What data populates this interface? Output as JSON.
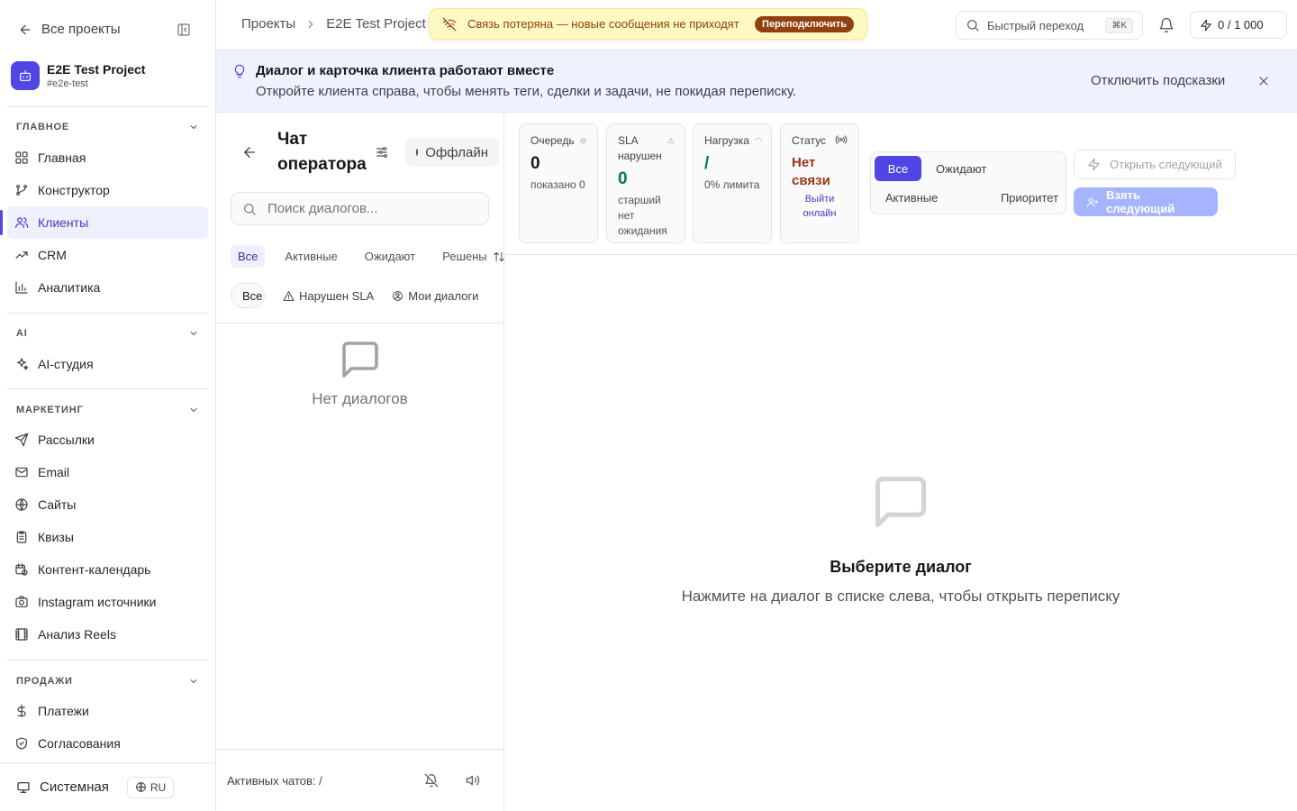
{
  "sidebar": {
    "back_label": "Все проекты",
    "project": {
      "name": "E2E Test Project",
      "slug": "#e2e-test"
    },
    "sections": {
      "main": {
        "title": "ГЛАВНОЕ",
        "items": [
          "Главная",
          "Конструктор",
          "Клиенты",
          "CRM",
          "Аналитика"
        ]
      },
      "ai": {
        "title": "AI",
        "items": [
          "AI-студия"
        ]
      },
      "marketing": {
        "title": "МАРКЕТИНГ",
        "items": [
          "Рассылки",
          "Email",
          "Сайты",
          "Квизы",
          "Контент-календарь",
          "Instagram источники",
          "Анализ Reels"
        ]
      },
      "sales": {
        "title": "ПРОДАЖИ",
        "items": [
          "Платежи",
          "Согласования"
        ]
      }
    },
    "active_item": "Клиенты",
    "theme_label": "Системная",
    "lang_label": "RU"
  },
  "header": {
    "breadcrumbs": [
      "Проекты",
      "E2E Test Project"
    ],
    "connection_banner": {
      "text": "Связь потеряна — новые сообщения не приходят",
      "action": "Переподключить"
    },
    "quick_search": {
      "placeholder": "Быстрый переход",
      "shortcut": "⌘K"
    },
    "credits": "0 / 1 000"
  },
  "hint": {
    "title": "Диалог и карточка клиента работают вместе",
    "text": "Откройте клиента справа, чтобы менять теги, сделки и задачи, не покидая переписку.",
    "disable_label": "Отключить подсказки"
  },
  "chat_list": {
    "title": "Чат оператора",
    "status": "Оффлайн",
    "search_placeholder": "Поиск диалогов...",
    "tabs": [
      "Все",
      "Активные",
      "Ожидают",
      "Решены"
    ],
    "active_tab": "Все",
    "select_value": "Все",
    "chips": [
      "Нарушен SLA",
      "Мои диалоги"
    ],
    "empty_label": "Нет диалогов",
    "footer_label": "Активных чатов: /"
  },
  "stats": {
    "queue": {
      "label": "Очередь",
      "value": "0",
      "sub": "показано 0"
    },
    "sla": {
      "label": "SLA нарушен",
      "value": "0",
      "sub": "старший нет ожидания"
    },
    "load": {
      "label": "Нагрузка",
      "value": "/",
      "sub": "0% лимита"
    },
    "status": {
      "label": "Статус",
      "value": "Нет связи",
      "link": "Выйти онлайн"
    }
  },
  "queue_filter": {
    "options": [
      "Все",
      "Ожидают",
      "Активные",
      "Приоритет"
    ],
    "selected": "Все"
  },
  "actions": {
    "open_next": "Открыть следующий",
    "take_next": "Взять следующий"
  },
  "empty_state": {
    "title": "Выберите диалог",
    "description": "Нажмите на диалог в списке слева, чтобы открыть переписку"
  },
  "colors": {
    "accent": "#4f46e5",
    "banner_bg": "#fef9c3",
    "warning_text": "#92400e",
    "hint_bg": "#eef2ff",
    "success": "#047857"
  }
}
